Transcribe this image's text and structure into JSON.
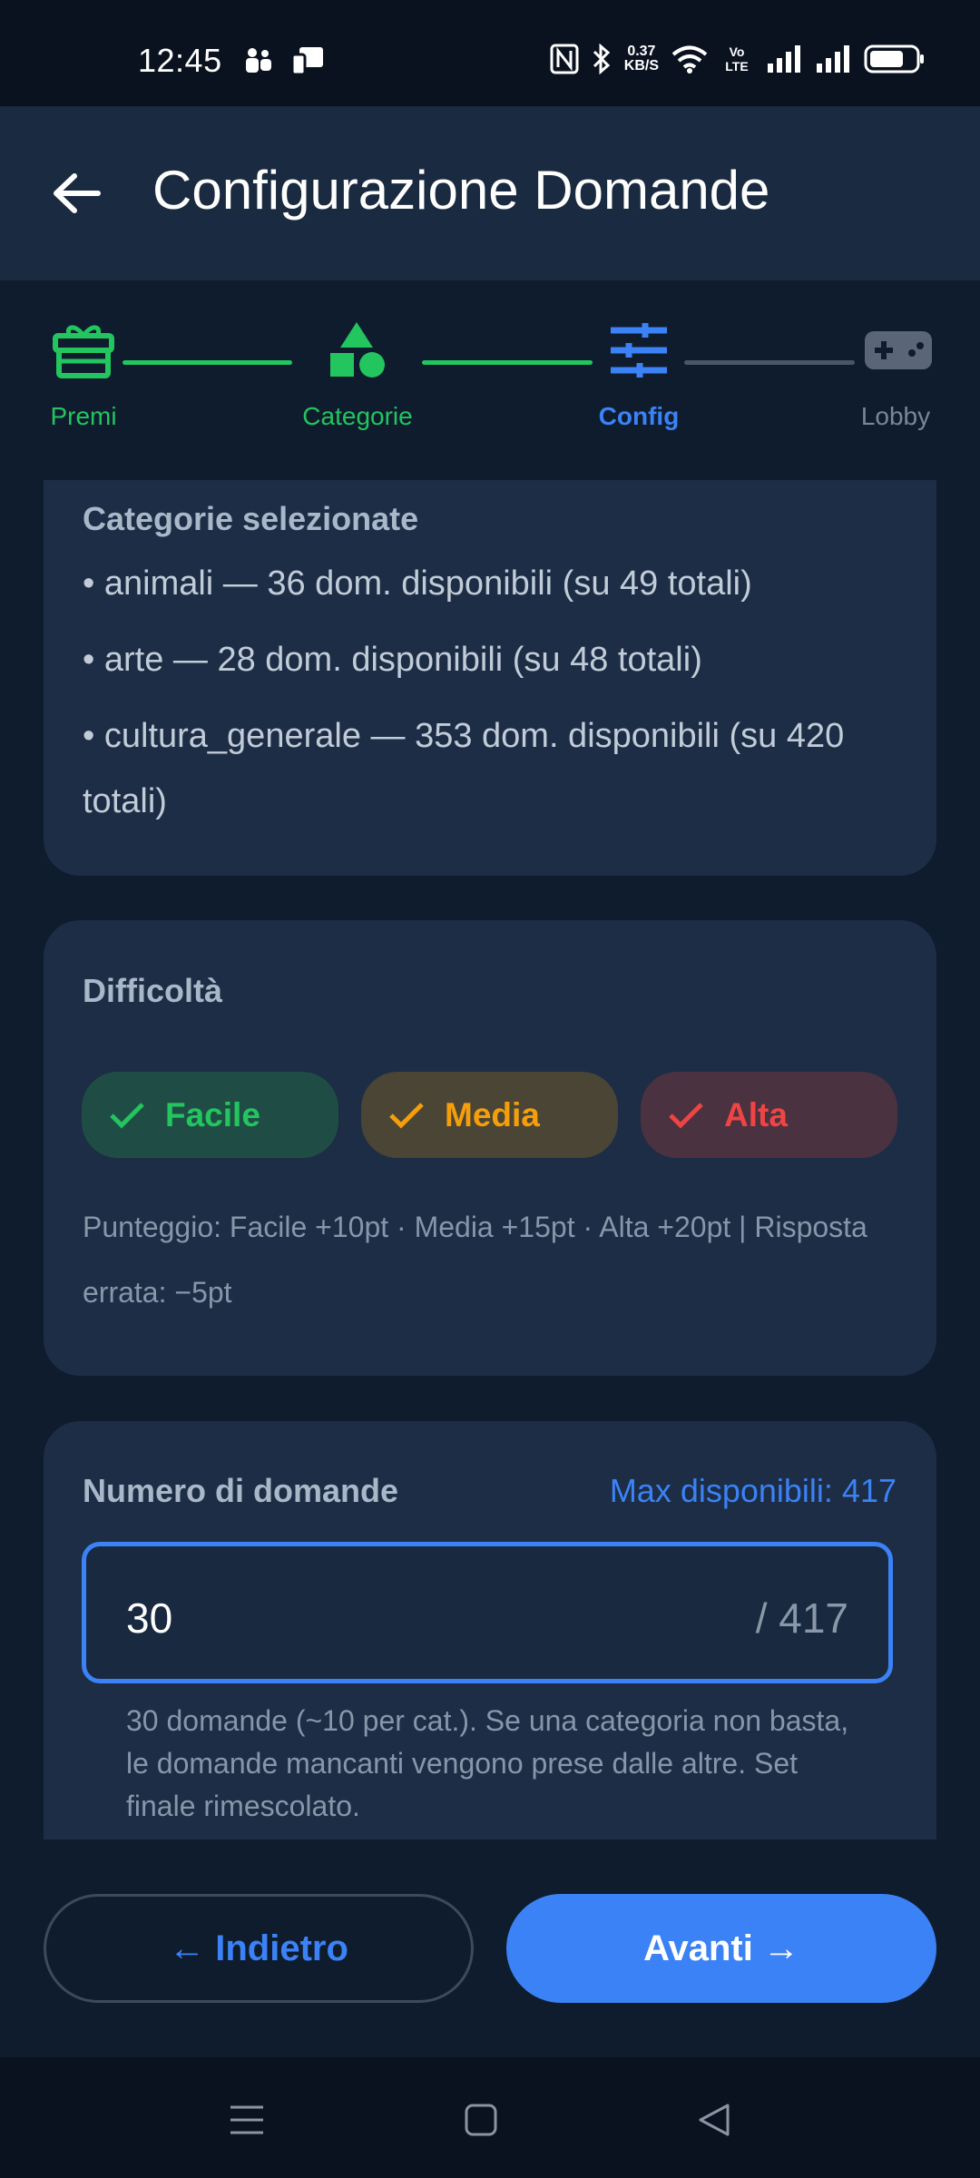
{
  "status_bar": {
    "time": "12:45",
    "speed_value": "0.37",
    "speed_unit": "KB/S",
    "network_label": "Vo LTE"
  },
  "app_bar": {
    "title": "Configurazione Domande"
  },
  "stepper": {
    "steps": [
      {
        "label": "Premi",
        "icon": "gift-icon",
        "state": "done"
      },
      {
        "label": "Categorie",
        "icon": "shapes-icon",
        "state": "done"
      },
      {
        "label": "Config",
        "icon": "tune-icon",
        "state": "active"
      },
      {
        "label": "Lobby",
        "icon": "gamepad-icon",
        "state": "pending"
      }
    ],
    "colors": {
      "done": "#22c55e",
      "active": "#3b82f6",
      "pending": "#6b7787"
    }
  },
  "categories_card": {
    "title": "Categorie selezionate",
    "items": [
      "• animali — 36 dom. disponibili (su 49 totali)",
      "• arte — 28 dom. disponibili (su 48 totali)",
      "• cultura_generale — 353 dom. disponibili (su 420 totali)"
    ]
  },
  "difficulty_card": {
    "title": "Difficoltà",
    "chips": [
      {
        "label": "Facile",
        "color": "#22c55e",
        "selected": true
      },
      {
        "label": "Media",
        "color": "#f59e0b",
        "selected": true
      },
      {
        "label": "Alta",
        "color": "#ef4444",
        "selected": true
      }
    ],
    "note": "Punteggio: Facile +10pt · Media +15pt · Alta +20pt  |  Risposta errata: −5pt"
  },
  "questions_card": {
    "title": "Numero di domande",
    "max_label": "Max disponibili: 417",
    "input_value": "30",
    "input_suffix": "/ 417",
    "help": "30 domande (~10 per cat.). Se una categoria non basta, le domande mancanti vengono prese dalle altre. Set finale rimescolato."
  },
  "buttons": {
    "back": "← Indietro",
    "next": "Avanti →"
  }
}
